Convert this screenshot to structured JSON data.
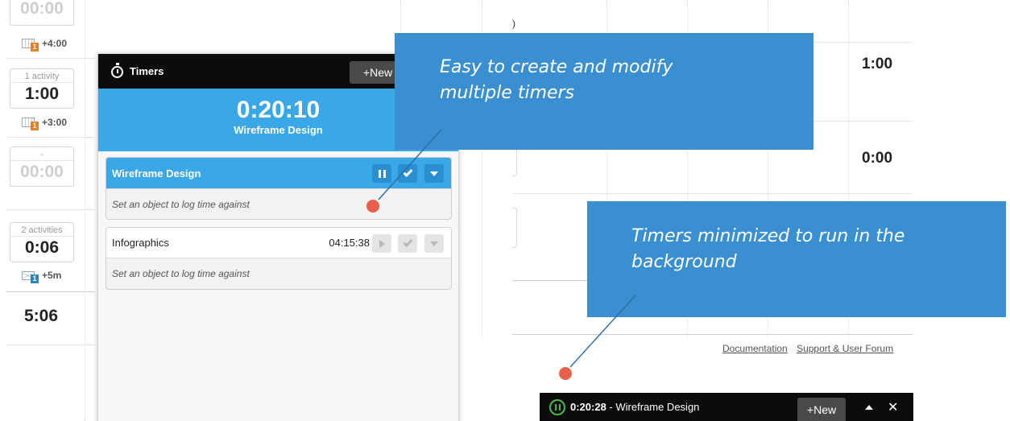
{
  "left_sheet": {
    "cells": [
      {
        "label": "",
        "value": "00:00",
        "dim": true,
        "extra": "+4:00",
        "extra_icon": "calendar-icon",
        "extra_badge": "1"
      },
      {
        "label": "1 activity",
        "value": "1:00",
        "dim": false,
        "extra": "+3:00",
        "extra_icon": "calendar-icon",
        "extra_badge": "1"
      },
      {
        "label": "-",
        "value": "00:00",
        "dim": true
      },
      {
        "label": "2 activities",
        "value": "0:06",
        "dim": false,
        "extra": "+5m",
        "extra_icon": "mail-icon",
        "extra_badge": "1"
      }
    ],
    "total": "5:06"
  },
  "right_sheet": {
    "values": [
      "1:00",
      "0:00"
    ],
    "partial_text": ")",
    "footer_links": [
      "Documentation",
      "Support & User Forum"
    ]
  },
  "timers_panel": {
    "title": "Timers",
    "new_label": "+New",
    "current": {
      "time": "0:20:10",
      "name": "Wireframe Design"
    },
    "timers": [
      {
        "name": "Wireframe Design",
        "elapsed": "",
        "hint": "Set an object to log time against",
        "active": true
      },
      {
        "name": "Infographics",
        "elapsed": "04:15:38",
        "hint": "Set an object to log time against",
        "active": false
      }
    ]
  },
  "mini_bar": {
    "time": "0:20:28",
    "separator": " - ",
    "name": "Wireframe Design",
    "new_label": "+New",
    "close_glyph": "✕"
  },
  "callouts": [
    {
      "text_line1": "Easy to create and modify",
      "text_line2": "multiple timers"
    },
    {
      "text_line1": "Timers minimized to run in the",
      "text_line2": "background"
    }
  ],
  "colors": {
    "timer_blue": "#3aa7e6",
    "callout_blue": "#3a8fd1",
    "dot_red": "#e8604a",
    "running_green": "#44bb44",
    "header_black": "#0c0c0c"
  }
}
